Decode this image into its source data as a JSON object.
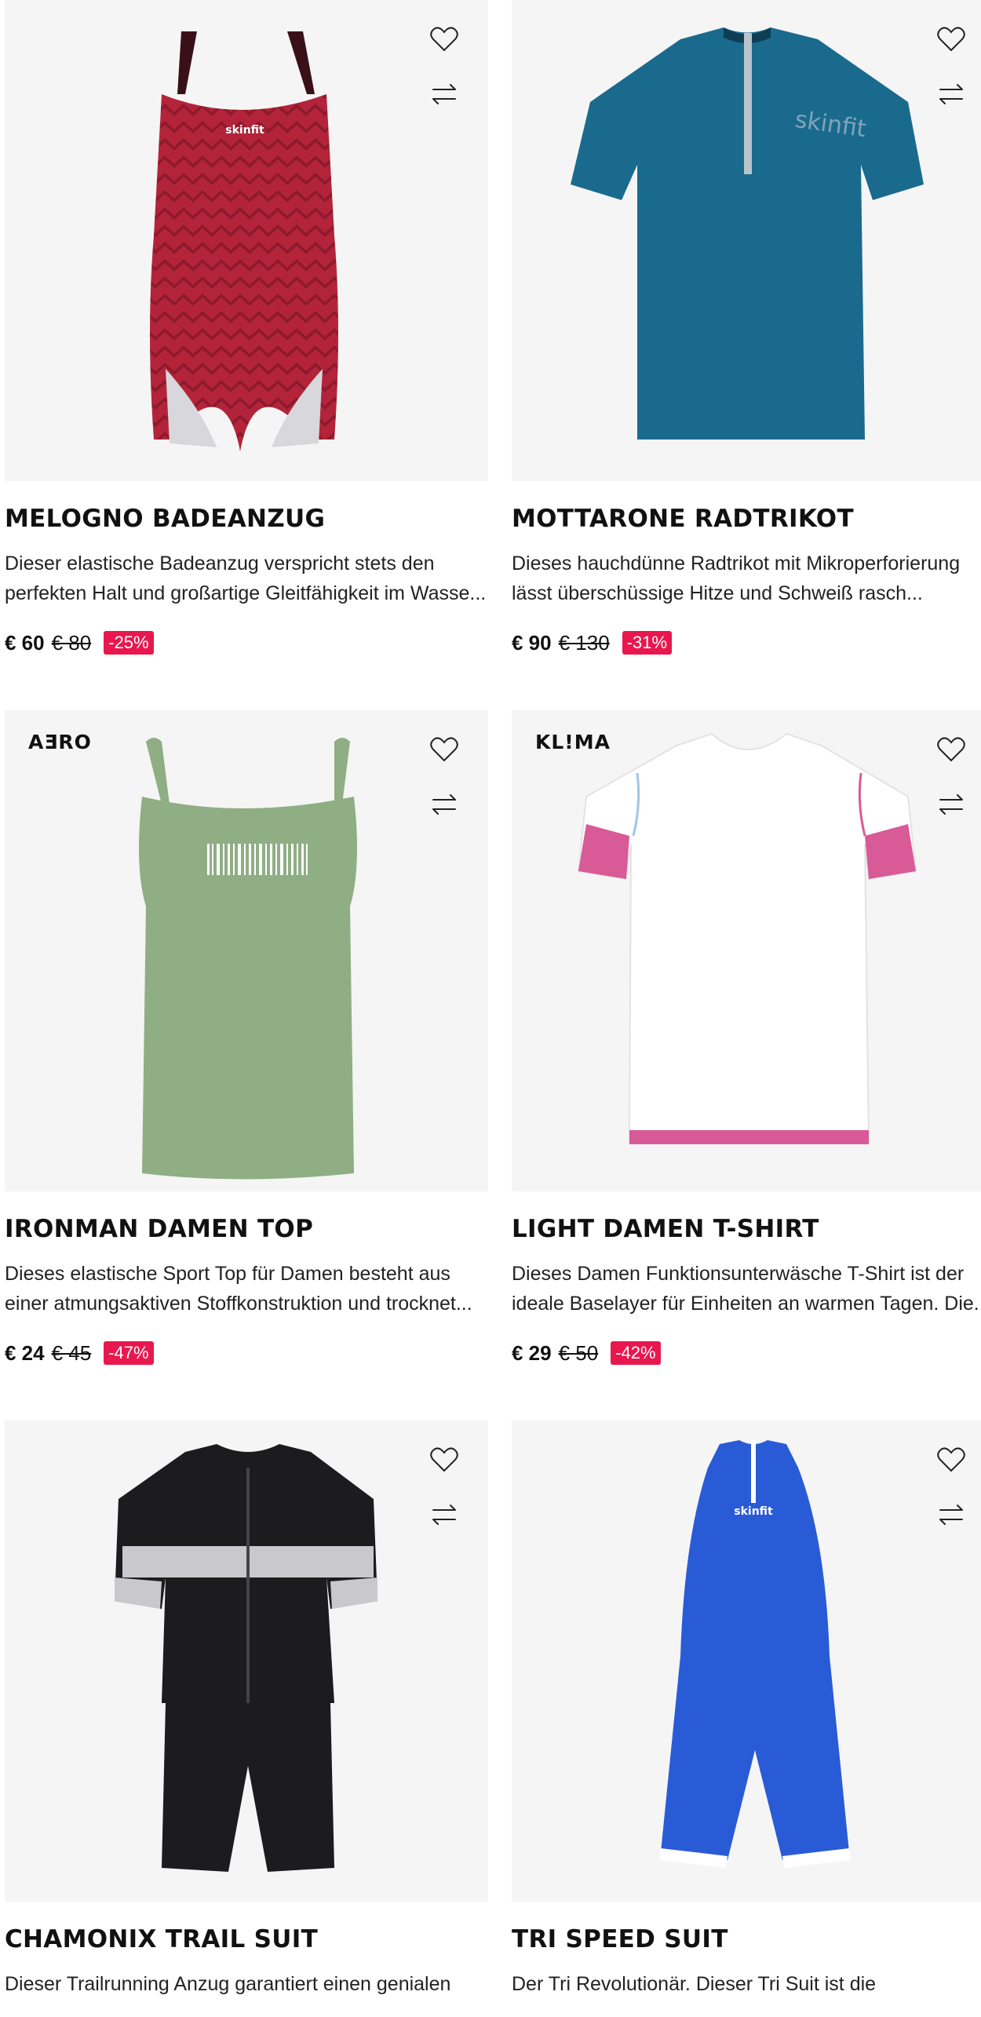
{
  "products": [
    {
      "name": "MELOGNO BADEANZUG",
      "desc_line1": "Dieser elastische Badeanzug verspricht stets den",
      "desc_line2": "perfekten Halt und großartige Gleitfähigkeit im Wasse...",
      "price": "€ 60",
      "old_price": "€ 80",
      "discount": "-25%",
      "tech_badge": "",
      "icon": "swimsuit-image",
      "color": "#b3243a"
    },
    {
      "name": "MOTTARONE RADTRIKOT",
      "desc_line1": "Dieses hauchdünne Radtrikot mit Mikroperforierung",
      "desc_line2": "lässt überschüssige Hitze und Schweiß rasch...",
      "price": "€ 90",
      "old_price": "€ 130",
      "discount": "-31%",
      "tech_badge": "",
      "icon": "cycling-jersey-image",
      "color": "#1a6a8e"
    },
    {
      "name": "IRONMAN DAMEN TOP",
      "desc_line1": "Dieses elastische Sport Top für Damen besteht aus",
      "desc_line2": "einer atmungsaktiven Stoffkonstruktion und trocknet...",
      "price": "€ 24",
      "old_price": "€ 45",
      "discount": "-47%",
      "tech_badge": "AƎRO",
      "icon": "tank-top-image",
      "color": "#8fae84"
    },
    {
      "name": "LIGHT DAMEN T-SHIRT",
      "desc_line1": "Dieses Damen Funktionsunterwäsche T-Shirt ist der",
      "desc_line2": "ideale Baselayer für Einheiten an warmen Tagen. Die...",
      "price": "€ 29",
      "old_price": "€ 50",
      "discount": "-42%",
      "tech_badge": "KL!MA",
      "icon": "t-shirt-image",
      "color": "#ffffff"
    },
    {
      "name": "CHAMONIX TRAIL SUIT",
      "desc_line1": "Dieser Trailrunning Anzug garantiert einen genialen",
      "desc_line2": "",
      "price": "",
      "old_price": "",
      "discount": "",
      "tech_badge": "",
      "icon": "trail-suit-image",
      "color": "#1c1c1e"
    },
    {
      "name": "TRI SPEED SUIT",
      "desc_line1": "Der Tri Revolutionär. Dieser Tri Suit ist die",
      "desc_line2": "",
      "price": "",
      "old_price": "",
      "discount": "",
      "tech_badge": "",
      "icon": "tri-suit-image",
      "color": "#2a5bd7"
    }
  ],
  "colors": {
    "discount_bg": "#e8174e",
    "card_bg": "#f5f5f5",
    "text": "#111111"
  }
}
